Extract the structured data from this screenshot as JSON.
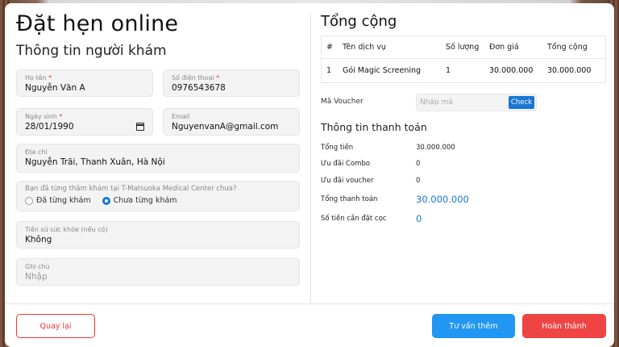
{
  "modal": {
    "title": "Đặt hẹn online",
    "left_section_title": "Thông tin người khám"
  },
  "form": {
    "name": {
      "label": "Họ tên",
      "value": "Nguyễn Văn A"
    },
    "phone": {
      "label": "Số điện thoại",
      "value": "0976543678"
    },
    "dob": {
      "label": "Ngày sinh",
      "value": "28/01/1990"
    },
    "email": {
      "label": "Email",
      "value": "NguyenvanA@gmail.com"
    },
    "address": {
      "label": "Địa chỉ",
      "value": "Nguyễn Trãi, Thanh Xuân, Hà Nội"
    },
    "visited": {
      "question": "Bạn đã từng thăm khám tại T-Matsuoka Medical Center chưa?",
      "option_yes": "Đã từng khám",
      "option_no": "Chưa từng khám",
      "selected": "option_no"
    },
    "history": {
      "label": "Tiền sử sức khỏe (nếu có)",
      "value": "Không"
    },
    "note": {
      "label": "Ghi chú",
      "placeholder": "Nhập"
    }
  },
  "summary": {
    "title": "Tổng cộng",
    "columns": [
      "#",
      "Tên dịch vụ",
      "Số lượng",
      "Đơn giá",
      "Tổng cộng"
    ],
    "rows": [
      {
        "index": "1",
        "service": "Gói Magic Screening",
        "qty": "1",
        "unit_price": "30.000.000",
        "total": "30.000.000"
      }
    ],
    "voucher": {
      "label": "Mã Voucher",
      "placeholder": "Nhập mã",
      "button": "Check"
    }
  },
  "payment": {
    "title": "Thông tin thanh toán",
    "total_label": "Tổng tiền",
    "total_value": "30.000.000",
    "combo_label": "Ưu đãi Combo",
    "combo_value": "0",
    "voucher_label": "Ưu đãi voucher",
    "voucher_value": "0",
    "grand_label": "Tổng thanh toán",
    "grand_value": "30.000.000",
    "deposit_label": "Số tiền cần đặt cọc",
    "deposit_value": "0"
  },
  "actions": {
    "back": "Quay lại",
    "consult": "Tư vấn thêm",
    "done": "Hoàn thành"
  },
  "colors": {
    "primary": "#1976d2",
    "danger": "#ef4444"
  }
}
